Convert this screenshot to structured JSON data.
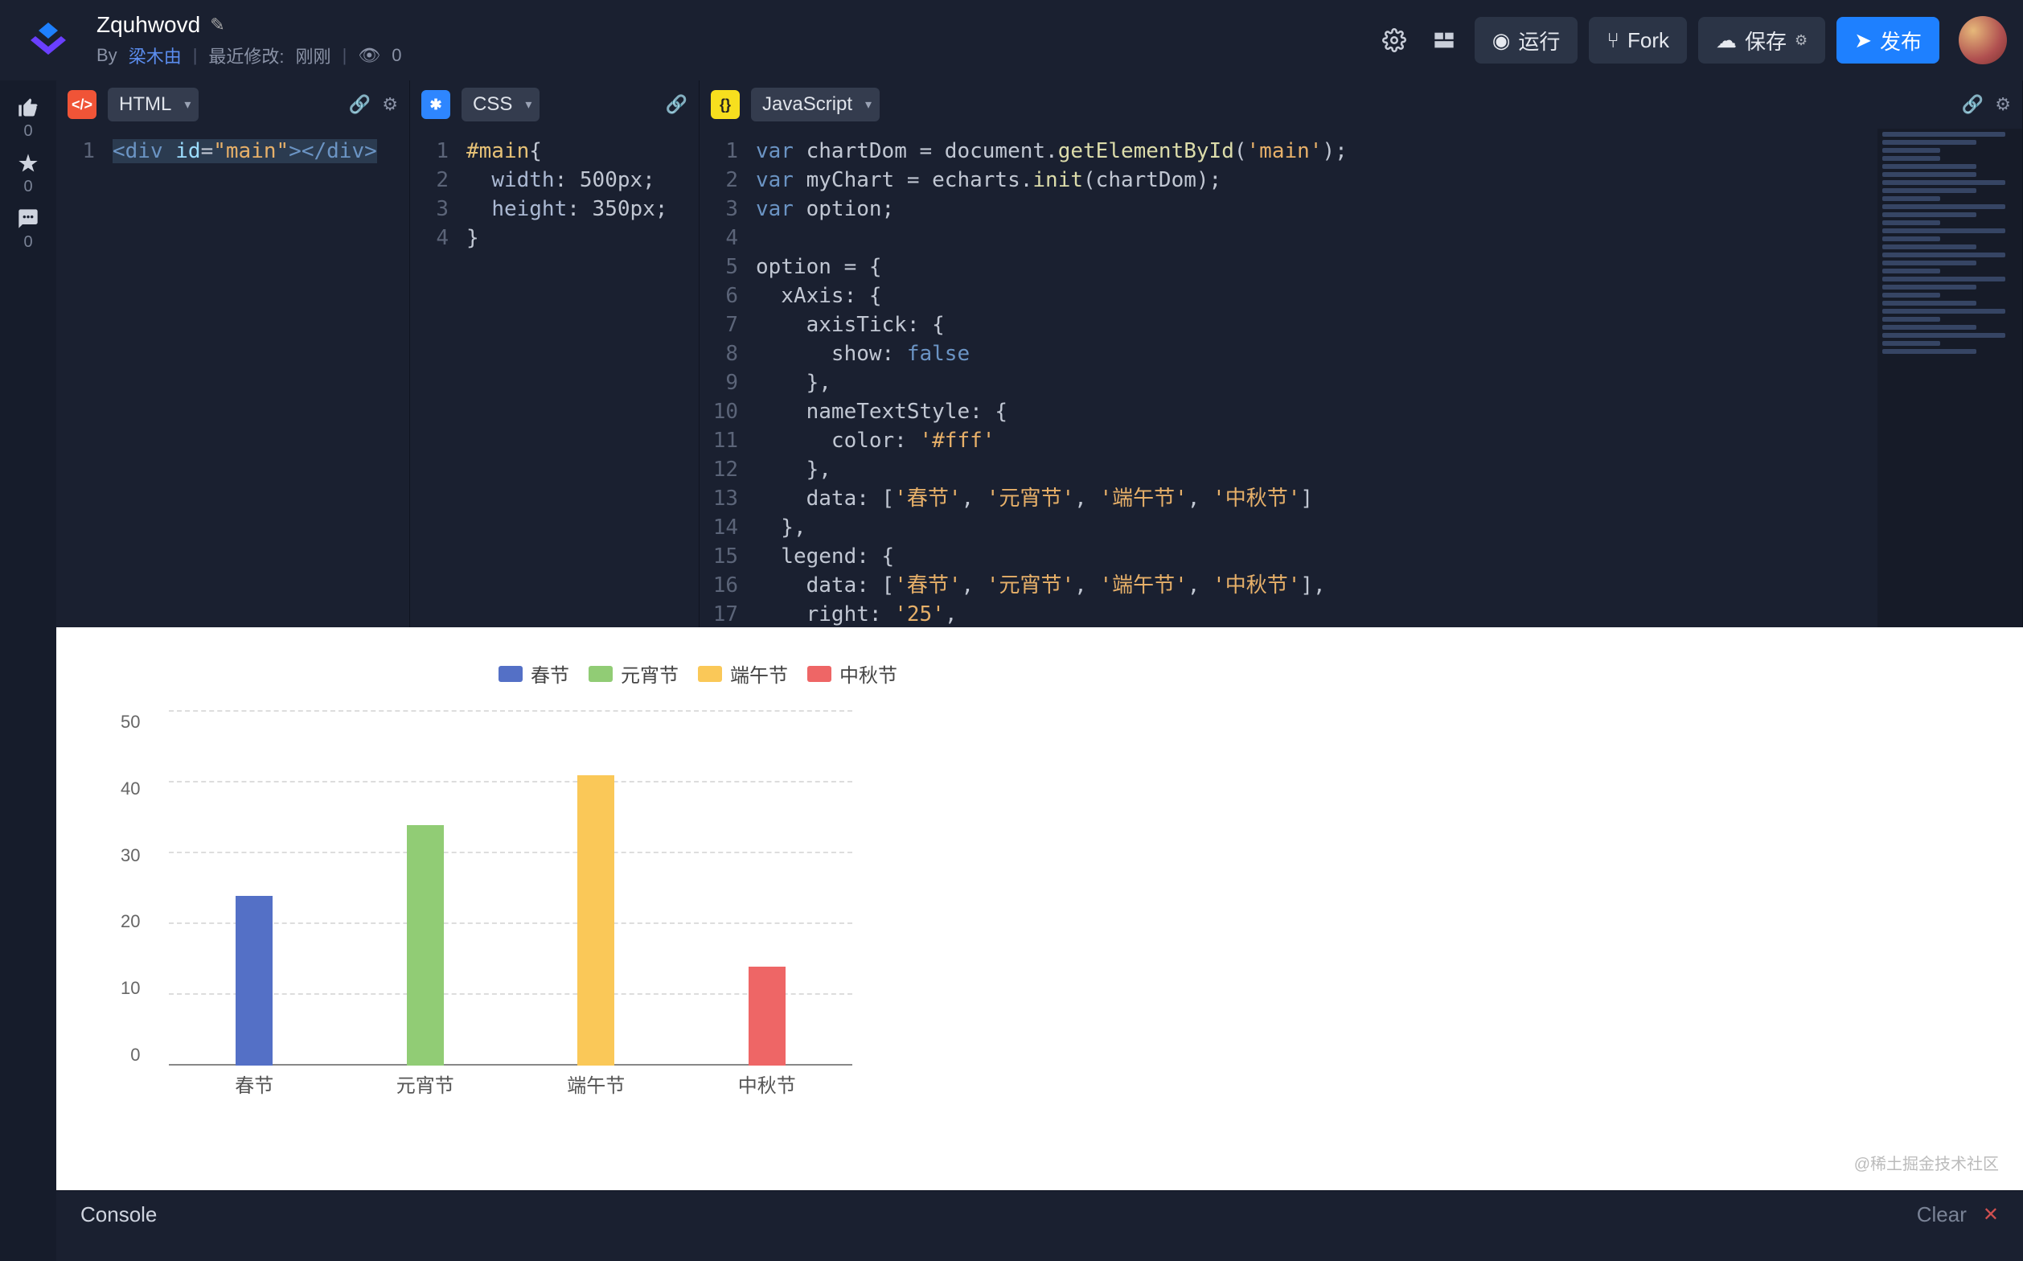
{
  "header": {
    "title": "Zquhwovd",
    "by_label": "By",
    "author": "梁木由",
    "last_modified_label": "最近修改:",
    "last_modified_value": "刚刚",
    "views": "0"
  },
  "actions": {
    "run": "运行",
    "fork": "Fork",
    "save": "保存",
    "publish": "发布"
  },
  "rail": {
    "like_count": "0",
    "star_count": "0",
    "comment_count": "0"
  },
  "panels": {
    "html_label": "HTML",
    "css_label": "CSS",
    "js_label": "JavaScript"
  },
  "code": {
    "html_lines": [
      "1"
    ],
    "html_text": "<div id=\"main\"></div>",
    "css_lines": [
      "1",
      "2",
      "3",
      "4"
    ],
    "css_text": "#main{\n  width: 500px;\n  height: 350px;\n}",
    "js_lines": [
      "1",
      "2",
      "3",
      "4",
      "5",
      "6",
      "7",
      "8",
      "9",
      "10",
      "11",
      "12",
      "13",
      "14",
      "15",
      "16",
      "17"
    ],
    "js_raw": [
      "var chartDom = document.getElementById('main');",
      "var myChart = echarts.init(chartDom);",
      "var option;",
      "",
      "option = {",
      "  xAxis: {",
      "    axisTick: {",
      "      show: false",
      "    },",
      "    nameTextStyle: {",
      "      color: '#fff'",
      "    },",
      "    data: ['春节', '元宵节', '端午节', '中秋节']",
      "  },",
      "  legend: {",
      "    data: ['春节', '元宵节', '端午节', '中秋节'],",
      "    right: '25',"
    ]
  },
  "chart_data": {
    "type": "bar",
    "categories": [
      "春节",
      "元宵节",
      "端午节",
      "中秋节"
    ],
    "series": [
      {
        "name": "春节",
        "color": "#5470c6"
      },
      {
        "name": "元宵节",
        "color": "#91cc75"
      },
      {
        "name": "端午节",
        "color": "#fac858"
      },
      {
        "name": "中秋节",
        "color": "#ee6666"
      }
    ],
    "values": [
      24,
      34,
      41,
      14
    ],
    "bar_colors": [
      "#5470c6",
      "#91cc75",
      "#fac858",
      "#ee6666"
    ],
    "ylim": [
      0,
      50
    ],
    "yticks": [
      0,
      10,
      20,
      30,
      40,
      50
    ],
    "title": "",
    "xlabel": "",
    "ylabel": "",
    "legend_position": "top"
  },
  "console": {
    "label": "Console",
    "clear": "Clear"
  },
  "watermark": "@稀土掘金技术社区"
}
